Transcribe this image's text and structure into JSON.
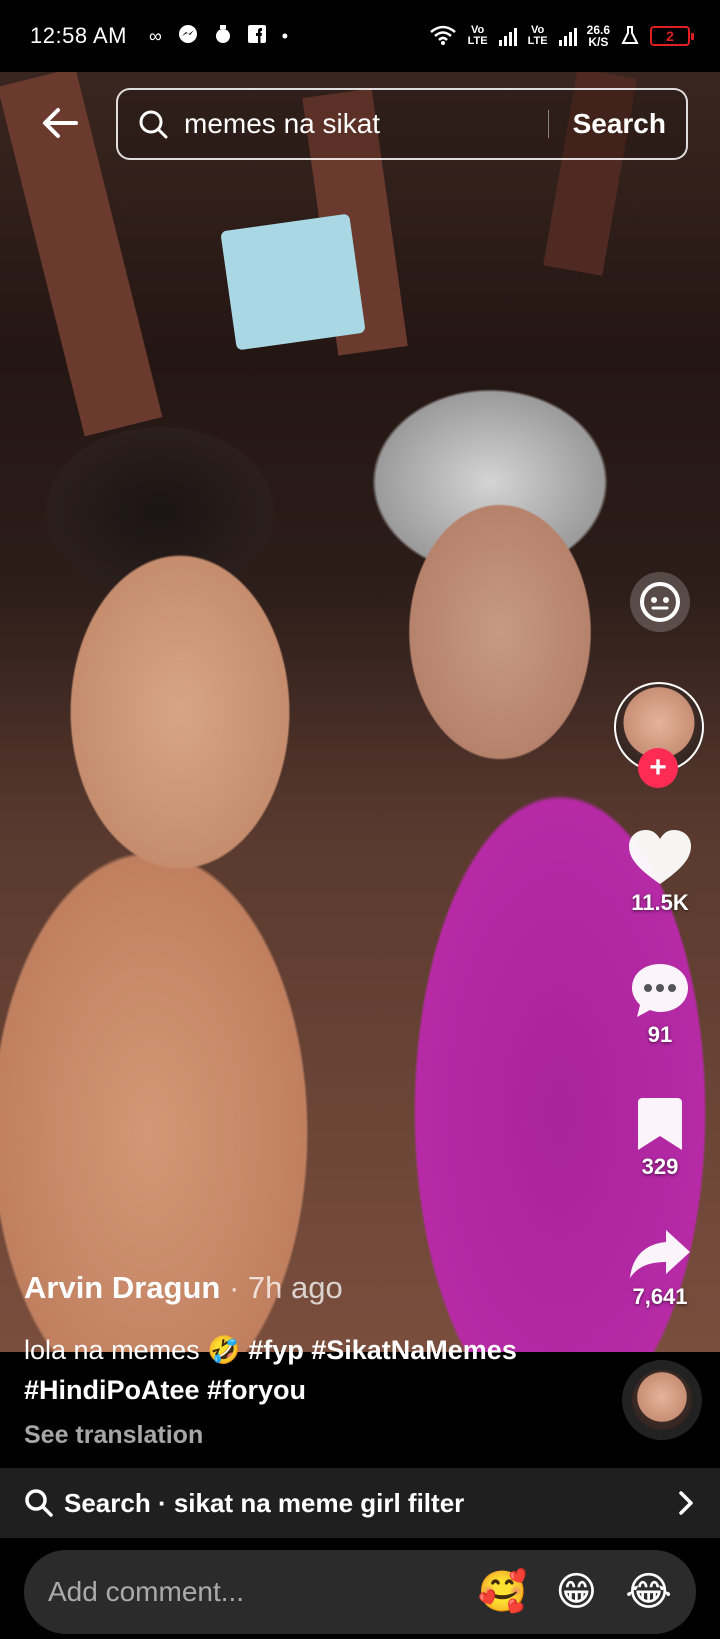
{
  "status_bar": {
    "time": "12:58 AM",
    "network_type_1": "Vo LTE",
    "network_type_2": "Vo LTE",
    "speed_value": "26.6",
    "speed_unit": "K/S",
    "battery": "2",
    "icons": [
      "infinity-icon",
      "messenger-icon",
      "money-bag-icon",
      "facebook-icon",
      "dot-icon",
      "wifi-icon",
      "signal-icon",
      "signal-icon",
      "flask-icon",
      "battery-icon"
    ]
  },
  "search": {
    "query": "memes na sikat",
    "button_label": "Search"
  },
  "rail": {
    "likes": "11.5K",
    "comments": "91",
    "saves": "329",
    "shares": "7,641"
  },
  "post": {
    "author": "Arvin Dragun",
    "time": " · 7h ago",
    "caption_text": "lola na memes 🤣 ",
    "tags_line1": "#fyp #SikatNaMemes",
    "tags_line2": "#HindiPoAtee #foryou",
    "see_translation": "See translation"
  },
  "related_search": {
    "label": "Search · sikat na meme girl filter"
  },
  "comment": {
    "placeholder": "Add comment...",
    "emojis": [
      "🥰",
      "😁",
      "😂"
    ]
  },
  "colors": {
    "accent": "#fe2c55",
    "battery_low": "#e02020"
  }
}
